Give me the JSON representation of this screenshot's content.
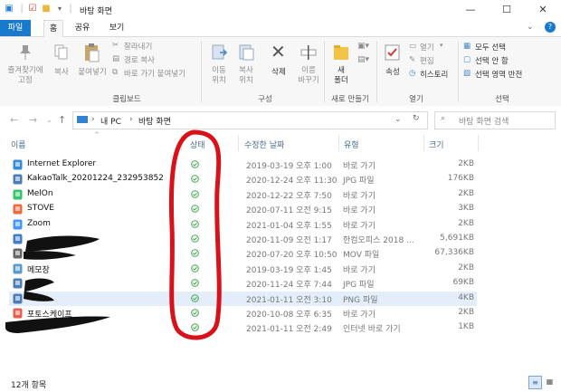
{
  "window": {
    "title": "바탕 화면",
    "minimize": "—",
    "maximize": "☐",
    "close": "✕"
  },
  "ribbon_tabs": {
    "file": "파일",
    "home": "홈",
    "share": "공유",
    "view": "보기"
  },
  "ribbon": {
    "pin_label": "즐겨찾기에\n고정",
    "copy_label": "복사",
    "paste_label": "붙여넣기",
    "cut_label": "잘라내기",
    "copy_path_label": "경로 복사",
    "paste_shortcut_label": "바로 가기 붙여넣기",
    "clipboard_group": "클립보드",
    "move_to_label": "이동\n위치",
    "copy_to_label": "복사\n위치",
    "delete_label": "삭제",
    "rename_label": "이름\n바꾸기",
    "organize_group": "구성",
    "new_folder_label": "새\n폴더",
    "new_group": "새로 만들기",
    "properties_label": "속성",
    "open_label": "열기",
    "edit_label": "편집",
    "history_label": "히스토리",
    "open_group": "열기",
    "select_all_label": "모두 선택",
    "select_none_label": "선택 안 함",
    "invert_selection_label": "선택 영역 반전",
    "select_group": "선택"
  },
  "address": {
    "path": [
      "내 PC",
      "바탕 화면"
    ],
    "search_placeholder": "바탕 화면 검색"
  },
  "columns": {
    "name": "이름",
    "status": "상태",
    "modified": "수정한 날짜",
    "type": "유형",
    "size": "크기"
  },
  "files": [
    {
      "name": "Internet Explorer",
      "date": "2019-03-19 오후 1:00",
      "type": "바로 가기",
      "size": "2KB",
      "icon": "internet-explorer-icon",
      "color": "#1e7fd8"
    },
    {
      "name": "KakaoTalk_20201224_232953852",
      "date": "2020-12-24 오후 11:30",
      "type": "JPG 파일",
      "size": "176KB",
      "icon": "image-file-icon",
      "color": "#3a6fb0"
    },
    {
      "name": "MelOn",
      "date": "2020-12-22 오후 7:50",
      "type": "바로 가기",
      "size": "2KB",
      "icon": "melon-icon",
      "color": "#1fbf5a"
    },
    {
      "name": "STOVE",
      "date": "2020-07-11 오전 9:15",
      "type": "바로 가기",
      "size": "3KB",
      "icon": "stove-icon",
      "color": "#f05a28"
    },
    {
      "name": "Zoom",
      "date": "2021-01-04 오후 1:55",
      "type": "바로 가기",
      "size": "2KB",
      "icon": "zoom-icon",
      "color": "#2d8cff"
    },
    {
      "name": "",
      "date": "2020-11-09 오전 1:17",
      "type": "한컴오피스 2018 ...",
      "size": "5,691KB",
      "icon": "hwp-file-icon",
      "color": "#2f6ec9"
    },
    {
      "name": "",
      "date": "2020-07-20 오후 10:50",
      "type": "MOV 파일",
      "size": "67,336KB",
      "icon": "video-file-icon",
      "color": "#555555"
    },
    {
      "name": "메모장",
      "date": "2019-03-19 오후 1:45",
      "type": "바로 가기",
      "size": "2KB",
      "icon": "notepad-icon",
      "color": "#4a90c8"
    },
    {
      "name": "",
      "date": "2020-11-24 오후 7:44",
      "type": "JPG 파일",
      "size": "69KB",
      "icon": "image-file-icon",
      "color": "#3a6fb0"
    },
    {
      "name": "",
      "date": "2021-01-11 오전 3:10",
      "type": "PNG 파일",
      "size": "4KB",
      "icon": "image-file-icon",
      "color": "#3a6fb0",
      "selected": true
    },
    {
      "name": "포토스케이프",
      "date": "2020-10-08 오후 6:35",
      "type": "바로 가기",
      "size": "2KB",
      "icon": "photoscape-icon",
      "color": "#e84c3d"
    },
    {
      "name": "",
      "date": "2021-01-11 오전 2:49",
      "type": "인터넷 바로 가기",
      "size": "1KB",
      "icon": "internet-shortcut-icon",
      "color": "#6a6a6a"
    }
  ],
  "statusbar": {
    "item_count": "12개 항목"
  },
  "colors": {
    "accent": "#1979ca",
    "sync_ok": "#3fa34d",
    "annotation": "#d9121a"
  }
}
